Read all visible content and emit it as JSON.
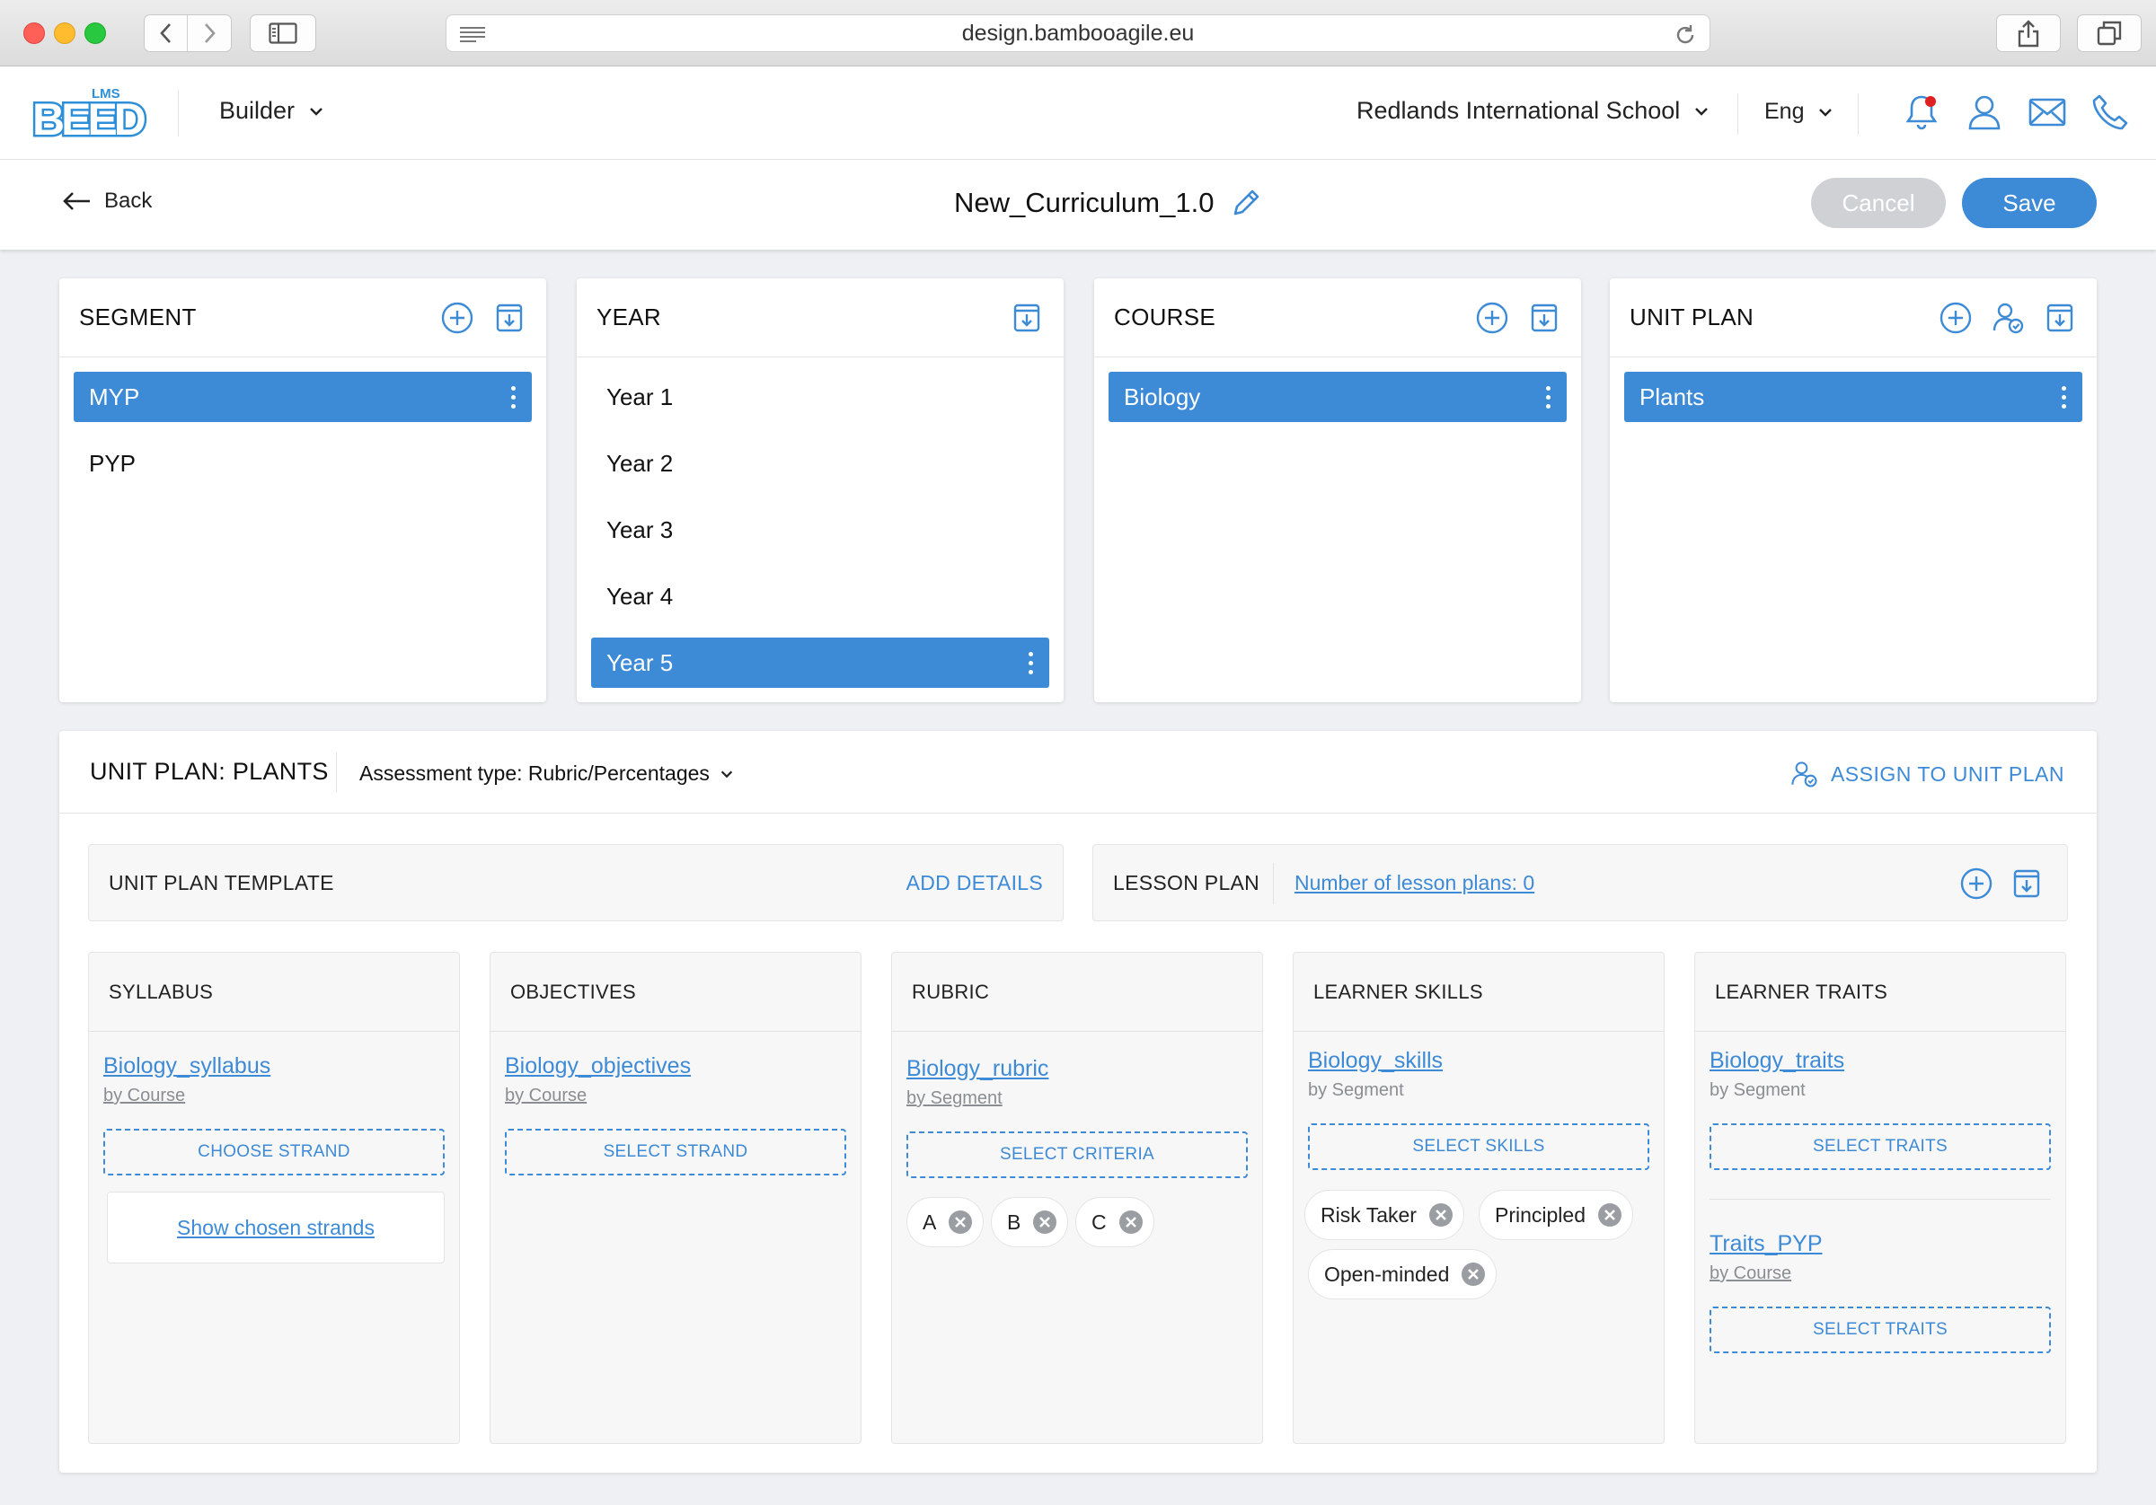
{
  "browser": {
    "url": "design.bambooagile.eu"
  },
  "header": {
    "logo_text": "BEED",
    "logo_badge": "LMS",
    "builder_label": "Builder",
    "school_label": "Redlands International School",
    "language_label": "Eng"
  },
  "subheader": {
    "back_label": "Back",
    "title": "New_Curriculum_1.0",
    "cancel_label": "Cancel",
    "save_label": "Save"
  },
  "columns": {
    "segment": {
      "title": "SEGMENT",
      "items": [
        "MYP",
        "PYP"
      ]
    },
    "year": {
      "title": "YEAR",
      "items": [
        "Year 1",
        "Year 2",
        "Year 3",
        "Year 4",
        "Year 5"
      ]
    },
    "course": {
      "title": "COURSE",
      "items": [
        "Biology"
      ]
    },
    "unit_plan": {
      "title": "UNIT PLAN",
      "items": [
        "Plants"
      ]
    }
  },
  "panel": {
    "title": "UNIT PLAN: PLANTS",
    "assessment_label": "Assessment type: Rubric/Percentages",
    "assign_label": "ASSIGN TO UNIT PLAN",
    "template_label": "UNIT PLAN TEMPLATE",
    "add_details_label": "ADD DETAILS",
    "lesson_label": "LESSON PLAN",
    "lesson_count_label": "Number of lesson plans: 0",
    "syllabus": {
      "title": "SYLLABUS",
      "doc": "Biology_syllabus",
      "by": "by Course",
      "action": "CHOOSE STRAND",
      "show_label": "Show chosen strands"
    },
    "objectives": {
      "title": "OBJECTIVES",
      "doc": "Biology_objectives",
      "by": "by Course",
      "action": "SELECT STRAND"
    },
    "rubric": {
      "title": "RUBRIC",
      "doc": "Biology_rubric",
      "by": "by Segment",
      "action": "SELECT CRITERIA",
      "chips": [
        "A",
        "B",
        "C"
      ]
    },
    "skills": {
      "title": "LEARNER SKILLS",
      "doc": "Biology_skills",
      "by": "by Segment",
      "action": "SELECT SKILLS",
      "chips": [
        "Risk Taker",
        "Principled",
        "Open-minded"
      ]
    },
    "traits": {
      "title": "LEARNER TRAITS",
      "doc": "Biology_traits",
      "by": "by Segment",
      "action": "SELECT TRAITS",
      "doc2": "Traits_PYP",
      "by2": "by Course",
      "action2": "SELECT TRAITS"
    }
  },
  "colors": {
    "accent": "#3d8ad6",
    "notification": "#e02020",
    "cancel_disabled": "#cfd1d4"
  },
  "icons": [
    "chevron-left-icon",
    "chevron-right-icon",
    "sidebar-icon",
    "reader-icon",
    "reload-icon",
    "share-icon",
    "tabs-icon",
    "bell-icon",
    "user-icon",
    "mail-icon",
    "phone-icon",
    "arrow-left-icon",
    "pencil-icon",
    "add-circle-icon",
    "archive-icon",
    "assign-user-icon",
    "kebab-icon",
    "clear-icon"
  ]
}
